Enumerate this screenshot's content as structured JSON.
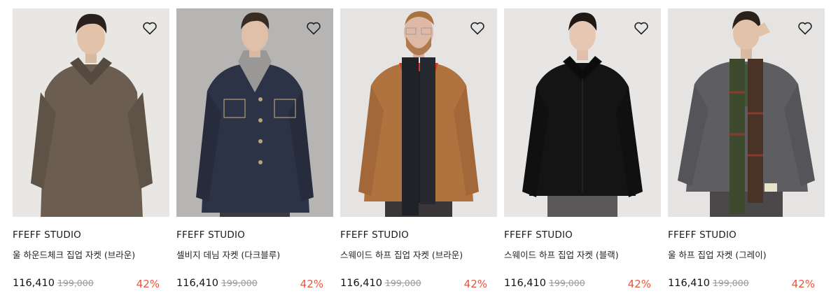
{
  "products": [
    {
      "brand": "FFEFF STUDIO",
      "name": "울 하운드체크 집업 자켓 (브라운)",
      "price": "116,410",
      "original_price": "199,000",
      "discount": "42%",
      "bg": "#e9e7e4",
      "jacket": "#6b5d50",
      "pants": "#c8b8a0",
      "inner": "#5a4e44"
    },
    {
      "brand": "FFEFF STUDIO",
      "name": "셀비지 데님 자켓 (다크블루)",
      "price": "116,410",
      "original_price": "199,000",
      "discount": "42%",
      "bg": "#b7b4b4",
      "jacket": "#2d3346",
      "pants": "#3a3a40",
      "inner": "#9a9896"
    },
    {
      "brand": "FFEFF STUDIO",
      "name": "스웨이드 하프 집업 자켓 (브라운)",
      "price": "116,410",
      "original_price": "199,000",
      "discount": "42%",
      "bg": "#e6e4e2",
      "jacket": "#b0723e",
      "pants": "#3a3536",
      "inner": "#1c1e22"
    },
    {
      "brand": "FFEFF STUDIO",
      "name": "스웨이드 하프 집업 자켓 (블랙)",
      "price": "116,410",
      "original_price": "199,000",
      "discount": "42%",
      "bg": "#e8e6e5",
      "jacket": "#141414",
      "pants": "#5a5858",
      "inner": "#1e1e1e"
    },
    {
      "brand": "FFEFF STUDIO",
      "name": "울 하프 집업 자켓 (그레이)",
      "price": "116,410",
      "original_price": "199,000",
      "discount": "42%",
      "bg": "#e6e4e2",
      "jacket": "#5e5e62",
      "pants": "#4a4848",
      "inner": "#3e5a3a"
    }
  ],
  "icons": {
    "wishlist": "heart-outline-icon"
  },
  "colors": {
    "discount": "#e8543a",
    "original_price": "#9a9a9a"
  }
}
